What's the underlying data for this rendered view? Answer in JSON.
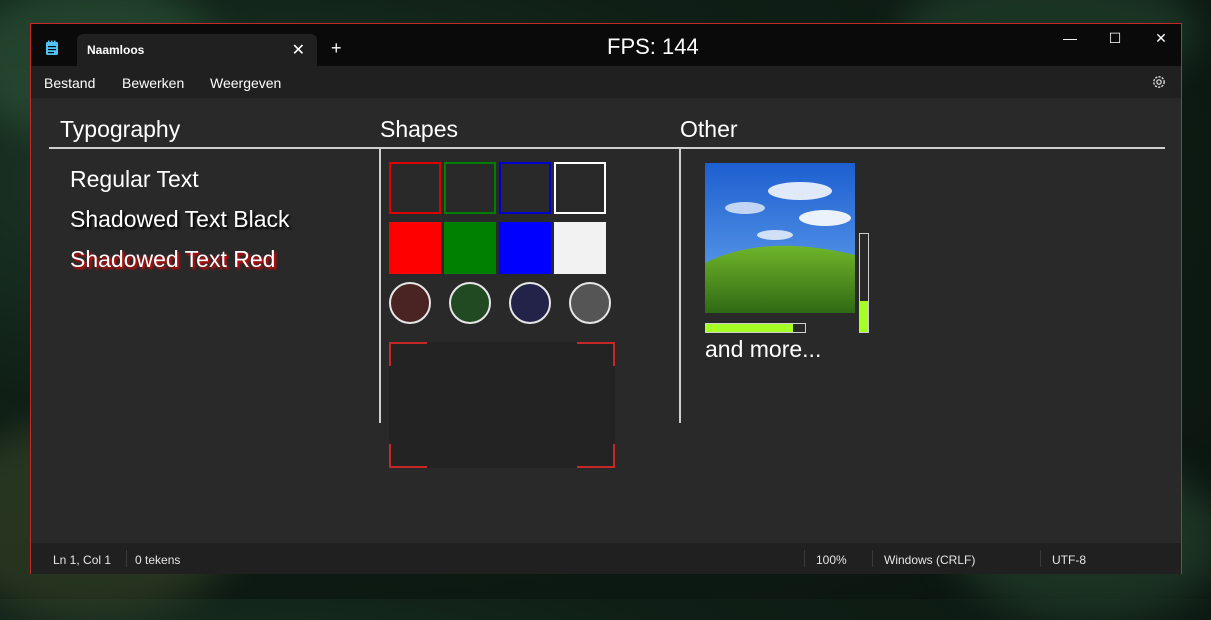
{
  "window": {
    "tab_title": "Naamloos",
    "tab_close": "✕",
    "new_tab": "+",
    "fps_label": "FPS: 144",
    "controls": {
      "minimize": "—",
      "maximize": "☐",
      "close": "✕"
    }
  },
  "menu": {
    "items": [
      "Bestand",
      "Bewerken",
      "Weergeven"
    ]
  },
  "columns": {
    "typography": "Typography",
    "shapes": "Shapes",
    "other": "Other"
  },
  "typography": {
    "regular": "Regular Text",
    "shadow_black": "Shadowed Text Black",
    "shadow_red": "Shadowed Text Red"
  },
  "shapes": {
    "outline_squares": [
      "#e00000",
      "#008000",
      "#0000d0",
      "#ffffff"
    ],
    "filled_squares": [
      "#ff0000",
      "#008000",
      "#0000ff",
      "#f2f2f2"
    ],
    "circles": [
      "#4a2323",
      "#214a23",
      "#23234a",
      "#555555"
    ],
    "corner_color": "#c62828"
  },
  "other": {
    "vertical_progress": 0.32,
    "horizontal_progress": 0.88,
    "accent": "#a6ff24",
    "and_more": "and more..."
  },
  "status": {
    "position": "Ln 1, Col 1",
    "chars": "0 tekens",
    "zoom": "100%",
    "line_endings": "Windows (CRLF)",
    "encoding": "UTF-8"
  }
}
